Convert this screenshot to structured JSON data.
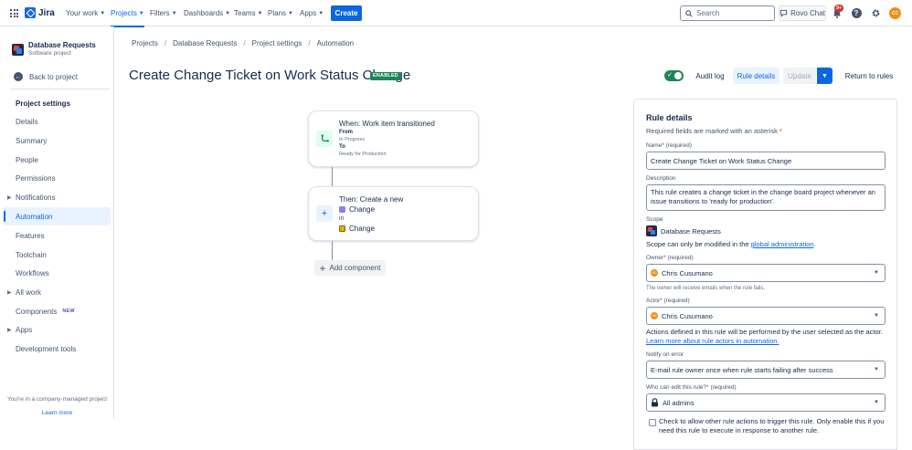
{
  "app": {
    "name": "Jira",
    "brand_color": "#1868db",
    "accent_color": "#0c66e4"
  },
  "topnav": {
    "items": [
      "Your work",
      "Projects",
      "Filters",
      "Dashboards",
      "Teams",
      "Plans",
      "Apps"
    ],
    "active": "Projects",
    "create_label": "Create",
    "search_placeholder": "Search",
    "rovo_label": "Rovo Chat",
    "notifications_badge": "9+",
    "user_initials": "CC"
  },
  "sidebar": {
    "project_name": "Database Requests",
    "project_type": "Software project",
    "back_label": "Back to project",
    "heading": "Project settings",
    "items": [
      {
        "label": "Details",
        "expandable": false
      },
      {
        "label": "Summary",
        "expandable": false
      },
      {
        "label": "People",
        "expandable": false
      },
      {
        "label": "Permissions",
        "expandable": false
      },
      {
        "label": "Notifications",
        "expandable": true
      },
      {
        "label": "Automation",
        "expandable": false,
        "active": true
      },
      {
        "label": "Features",
        "expandable": false
      },
      {
        "label": "Toolchain",
        "expandable": false
      },
      {
        "label": "Workflows",
        "expandable": false
      },
      {
        "label": "All work",
        "expandable": true
      },
      {
        "label": "Components",
        "expandable": false,
        "badge": "NEW"
      },
      {
        "label": "Apps",
        "expandable": true
      },
      {
        "label": "Development tools",
        "expandable": false
      }
    ],
    "footer_note": "You're in a company-managed project",
    "footer_link": "Learn more"
  },
  "breadcrumb": [
    "Projects",
    "Database Requests",
    "Project settings",
    "Automation"
  ],
  "rule": {
    "title": "Create Change Ticket on Work Status Change",
    "status_badge": "ENABLED",
    "enabled": true
  },
  "toolbar": {
    "audit_log": "Audit log",
    "rule_details": "Rule details",
    "update": "Update",
    "return": "Return to rules"
  },
  "canvas": {
    "trigger": {
      "title": "When: Work item transitioned",
      "from_label": "From",
      "from_value": "In Progress",
      "to_label": "To",
      "to_value": "Ready for Production"
    },
    "action": {
      "title": "Then: Create a new",
      "type_value": "Change",
      "in_label": "in",
      "project_value": "Change"
    },
    "add_component": "Add component"
  },
  "panel": {
    "title": "Rule details",
    "required_note": "Required fields are marked with an asterisk",
    "name_label": "Name",
    "name_req": "(required)",
    "name_value": "Create Change Ticket on Work Status Change",
    "description_label": "Description",
    "description_value": "This rule creates a change ticket in the change board project whenever an issue transitions to 'ready for production'.",
    "scope_label": "Scope",
    "scope_value": "Database Requests",
    "scope_note_prefix": "Scope can only be modified in the ",
    "scope_note_link": "global administration",
    "scope_note_suffix": ".",
    "owner_label": "Owner",
    "owner_req": "(required)",
    "owner_value": "Chris Cusumano",
    "owner_initials": "CC",
    "owner_helper": "The owner will receive emails when the rule fails.",
    "actor_label": "Actor",
    "actor_req": "(required)",
    "actor_value": "Chris Cusumano",
    "actor_initials": "CC",
    "actor_note": "Actions defined in this rule will be performed by the user selected as the actor.",
    "actor_link": "Learn more about rule actors in automation.",
    "notify_label": "Notify on error",
    "notify_value": "E-mail rule owner once when rule starts failing after success",
    "edit_label": "Who can edit this rule?",
    "edit_req": "(required)",
    "edit_value": "All admins",
    "allow_trigger_text": "Check to allow other rule actions to trigger this rule. Only enable this if you need this rule to execute in response to another rule.",
    "allow_trigger_checked": false
  }
}
